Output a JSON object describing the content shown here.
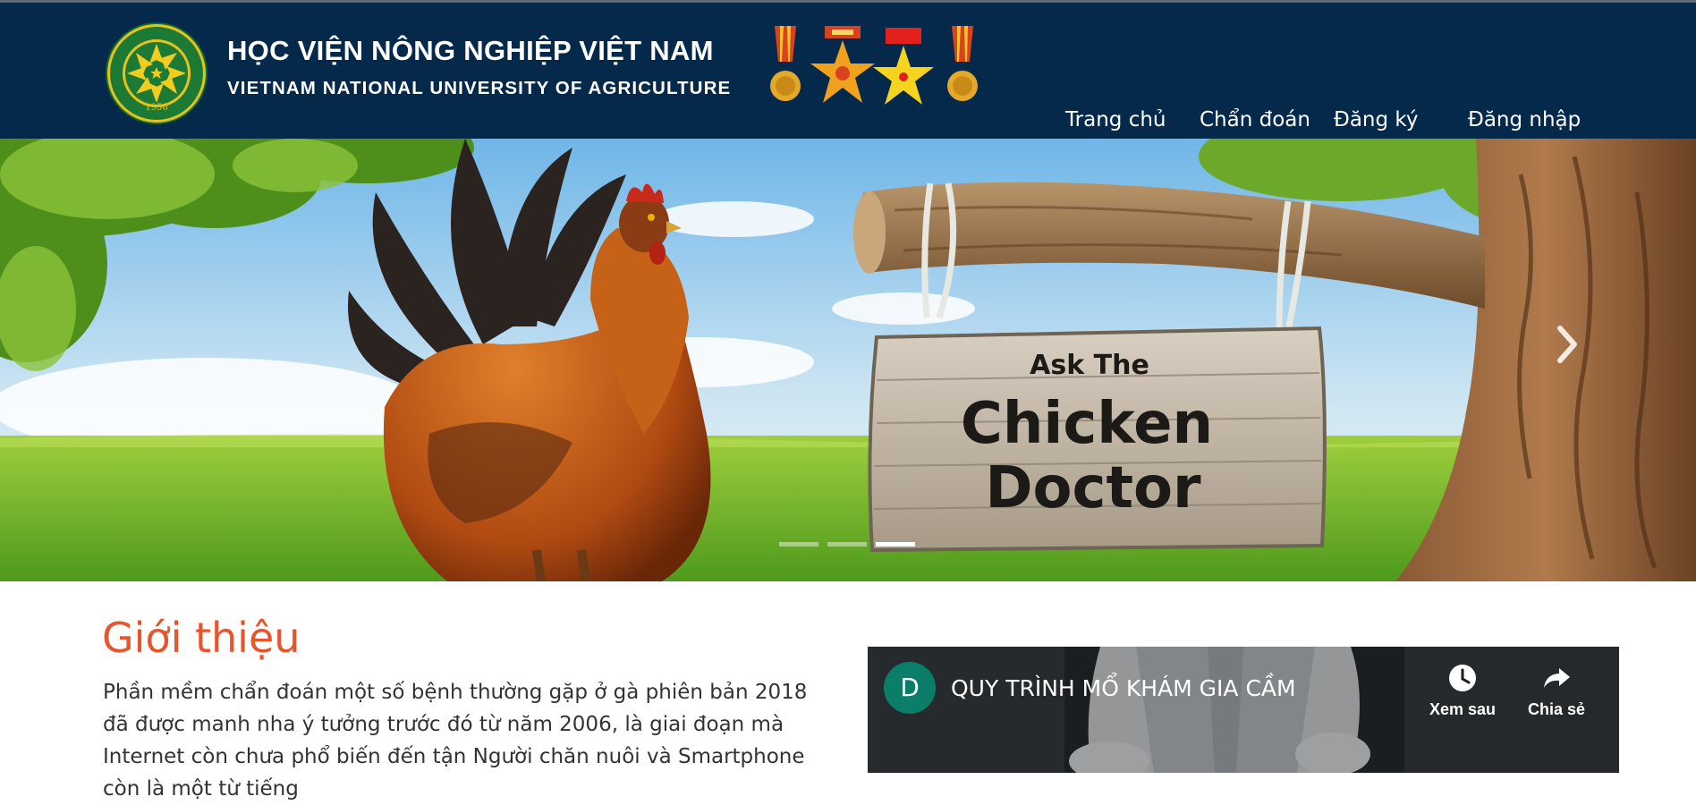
{
  "header": {
    "title_vi": "HỌC VIỆN NÔNG NGHIỆP VIỆT NAM",
    "title_en": "VIETNAM NATIONAL UNIVERSITY OF AGRICULTURE",
    "logo_year": "1956",
    "background_color": "#04294b"
  },
  "nav": {
    "items": [
      {
        "label": "Trang chủ"
      },
      {
        "label": "Chẩn đoán"
      },
      {
        "label": "Đăng ký"
      },
      {
        "label": "Đăng nhập"
      }
    ]
  },
  "hero": {
    "sign_line1": "Ask The",
    "sign_line2": "Chicken",
    "sign_line3": "Doctor",
    "slide_count": 3,
    "active_slide": 3,
    "next_icon": "chevron-right-icon"
  },
  "intro": {
    "title": "Giới thiệu",
    "text": "Phần mềm chẩn đoán một số bệnh thường gặp ở gà phiên bản 2018 đã được manh nha ý tưởng trước đó từ năm 2006, là giai đoạn mà Internet còn chưa phổ biến đến tận Người chăn nuôi và Smartphone còn là một từ tiếng",
    "title_color": "#e8552d"
  },
  "video": {
    "channel_initial": "D",
    "title": "QUY TRÌNH MỔ KHÁM GIA CẦM",
    "watch_later_label": "Xem sau",
    "share_label": "Chia sẻ",
    "avatar_color": "#0b7e6a"
  }
}
